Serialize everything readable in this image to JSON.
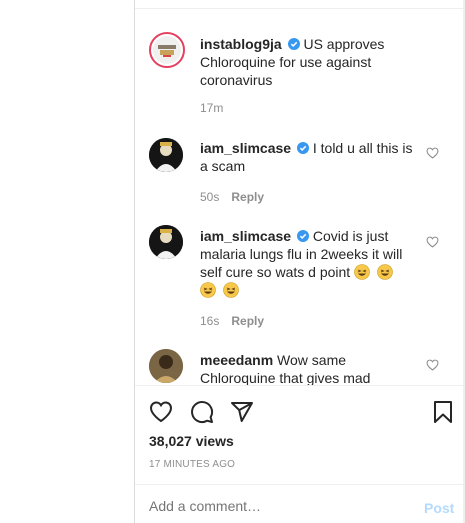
{
  "comments": [
    {
      "username": "instablog9ja",
      "text": "US approves Chloroquine for use against coronavirus",
      "time": "17m",
      "reply": ""
    },
    {
      "username": "iam_slimcase",
      "text": "I told u all this is a scam",
      "time": "50s",
      "reply": "Reply"
    },
    {
      "username": "iam_slimcase",
      "text": "Covid is just malaria lungs flu in 2weeks it will self cure so wats d point",
      "time": "16s",
      "reply": "Reply"
    },
    {
      "username": "meeedanm",
      "text": "Wow same Chloroquine that gives mad",
      "time": "",
      "reply": ""
    }
  ],
  "stats": {
    "views": "38,027 views",
    "timestamp": "17 MINUTES AGO"
  },
  "add_comment": {
    "placeholder": "Add a comment…",
    "post_label": "Post"
  },
  "icons": {
    "like": "heart-icon",
    "comment": "comment-icon",
    "share": "share-icon",
    "save": "bookmark-icon",
    "verified": "verified-badge-icon",
    "comment_like": "heart-small-icon",
    "emoji": "laughing-emoji-icon"
  },
  "colors": {
    "verified_blue": "#3897f0",
    "post_disabled": "#b3dbff",
    "muted_text": "#8e8e8e"
  }
}
